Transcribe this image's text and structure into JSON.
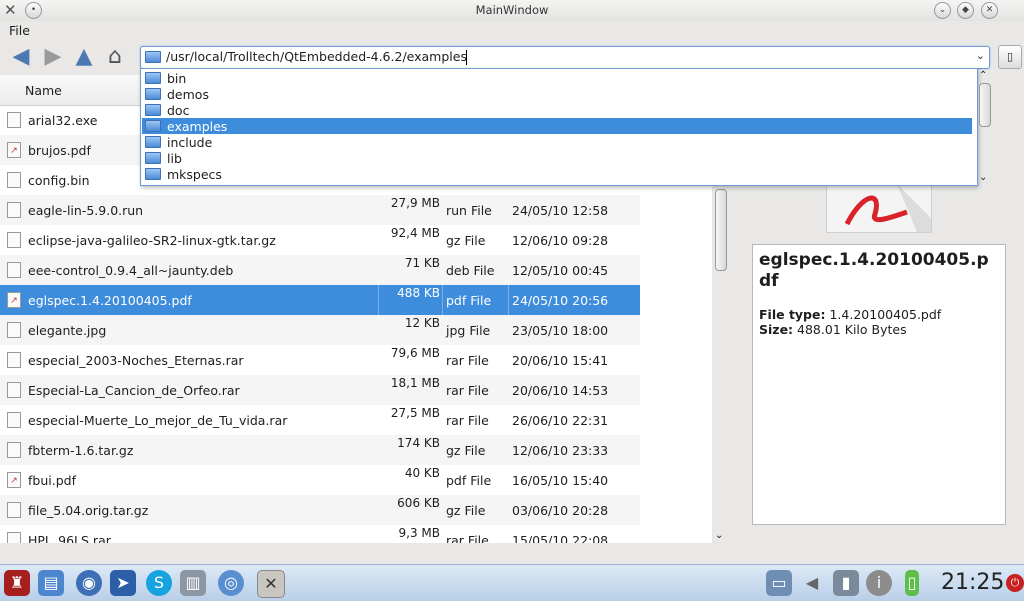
{
  "window": {
    "title": "MainWindow"
  },
  "menu": {
    "file": "File"
  },
  "path": {
    "value": "/usr/local/Trolltech/QtEmbedded-4.6.2/examples"
  },
  "dropdown": {
    "items": [
      {
        "label": "bin",
        "selected": false
      },
      {
        "label": "demos",
        "selected": false
      },
      {
        "label": "doc",
        "selected": false
      },
      {
        "label": "examples",
        "selected": true
      },
      {
        "label": "include",
        "selected": false
      },
      {
        "label": "lib",
        "selected": false
      },
      {
        "label": "mkspecs",
        "selected": false
      }
    ]
  },
  "list": {
    "header_name": "Name",
    "rows": [
      {
        "name": "arial32.exe",
        "size": "",
        "type": "",
        "date": "",
        "icon": "exe-icon"
      },
      {
        "name": "brujos.pdf",
        "size": "",
        "type": "",
        "date": "",
        "icon": "pdf-icon"
      },
      {
        "name": "config.bin",
        "size": "",
        "type": "",
        "date": "",
        "icon": "bin-icon"
      },
      {
        "name": "eagle-lin-5.9.0.run",
        "size": "27,9 MB",
        "type": "run File",
        "date": "24/05/10 12:58",
        "icon": "run-icon"
      },
      {
        "name": "eclipse-java-galileo-SR2-linux-gtk.tar.gz",
        "size": "92,4 MB",
        "type": "gz File",
        "date": "12/06/10 09:28",
        "icon": "archive-icon"
      },
      {
        "name": "eee-control_0.9.4_all~jaunty.deb",
        "size": "71 KB",
        "type": "deb File",
        "date": "12/05/10 00:45",
        "icon": "deb-icon"
      },
      {
        "name": "eglspec.1.4.20100405.pdf",
        "size": "488 KB",
        "type": "pdf File",
        "date": "24/05/10 20:56",
        "icon": "pdf-icon",
        "selected": true
      },
      {
        "name": "elegante.jpg",
        "size": "12 KB",
        "type": "jpg File",
        "date": "23/05/10 18:00",
        "icon": "image-icon"
      },
      {
        "name": "especial_2003-Noches_Eternas.rar",
        "size": "79,6 MB",
        "type": "rar File",
        "date": "20/06/10 15:41",
        "icon": "rar-icon"
      },
      {
        "name": "Especial-La_Cancion_de_Orfeo.rar",
        "size": "18,1 MB",
        "type": "rar File",
        "date": "20/06/10 14:53",
        "icon": "rar-icon"
      },
      {
        "name": "especial-Muerte_Lo_mejor_de_Tu_vida.rar",
        "size": "27,5 MB",
        "type": "rar File",
        "date": "26/06/10 22:31",
        "icon": "rar-icon"
      },
      {
        "name": "fbterm-1.6.tar.gz",
        "size": "174 KB",
        "type": "gz File",
        "date": "12/06/10 23:33",
        "icon": "archive-icon"
      },
      {
        "name": "fbui.pdf",
        "size": "40 KB",
        "type": "pdf File",
        "date": "16/05/10 15:40",
        "icon": "pdf-icon"
      },
      {
        "name": "file_5.04.orig.tar.gz",
        "size": "606 KB",
        "type": "gz File",
        "date": "03/06/10 20:28",
        "icon": "archive-icon"
      },
      {
        "name": "HPL_96LS.rar",
        "size": "9,3 MB",
        "type": "rar File",
        "date": "15/05/10 22:08",
        "icon": "rar-icon"
      }
    ]
  },
  "preview": {
    "title": "eglspec.1.4.20100405.pdf",
    "file_type_label": "File type:",
    "file_type_value": "1.4.20100405.pdf",
    "size_label": "Size:",
    "size_value": "488.01 Kilo Bytes"
  },
  "taskbar": {
    "clock": "21:25"
  }
}
